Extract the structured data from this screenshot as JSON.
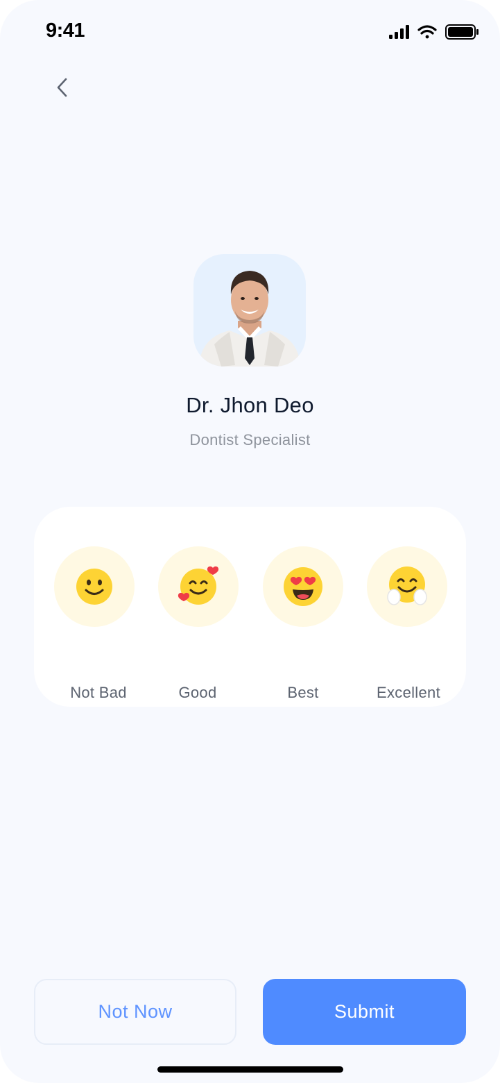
{
  "status_bar": {
    "time": "9:41"
  },
  "doctor": {
    "name": "Dr. Jhon Deo",
    "specialty": "Dontist Specialist"
  },
  "rating_options": [
    {
      "label": "Not Bad",
      "icon": "slightly-smiling-face-icon"
    },
    {
      "label": "Good",
      "icon": "smiling-face-with-hearts-icon"
    },
    {
      "label": "Best",
      "icon": "heart-eyes-face-icon"
    },
    {
      "label": "Excellent",
      "icon": "hugging-face-icon"
    }
  ],
  "actions": {
    "not_now_label": "Not Now",
    "submit_label": "Submit"
  },
  "colors": {
    "background": "#f7f9fe",
    "accent": "#4f8bff",
    "emoji_bg": "#fff9e3",
    "emoji_yellow": "#fdd334"
  }
}
